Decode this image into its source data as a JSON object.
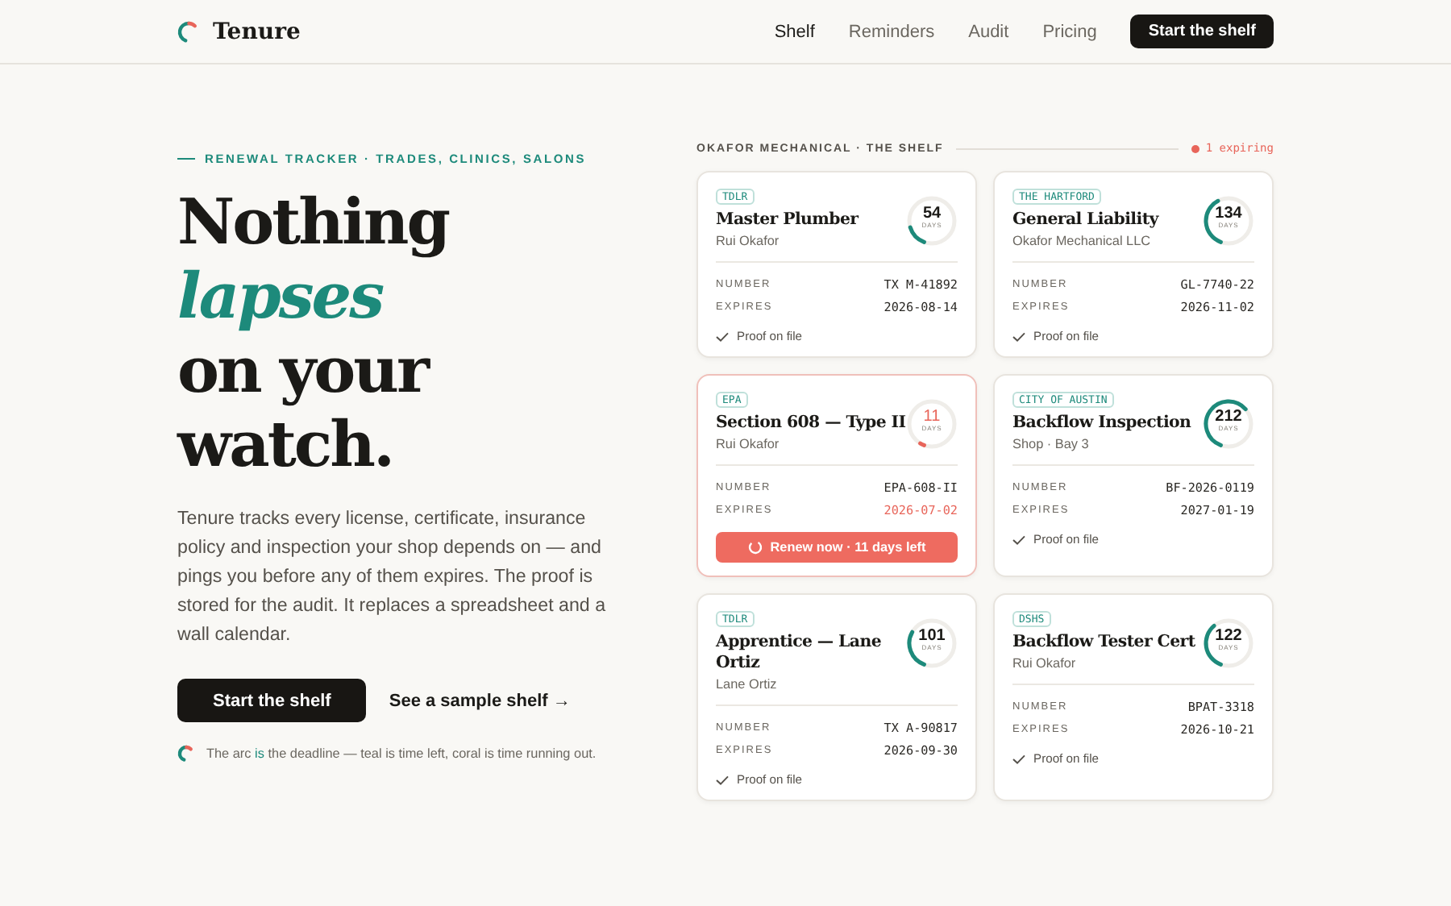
{
  "brand": {
    "name": "Tenure"
  },
  "nav": {
    "links": [
      {
        "label": "Shelf",
        "selected": true
      },
      {
        "label": "Reminders",
        "selected": false
      },
      {
        "label": "Audit",
        "selected": false
      },
      {
        "label": "Pricing",
        "selected": false
      }
    ],
    "cta": "Start the shelf"
  },
  "hero": {
    "eyebrow": "RENEWAL TRACKER · TRADES, CLINICS, SALONS",
    "headline": "Nothing *lapses* on your watch.",
    "body": "Tenure tracks every license, certificate, insurance policy and inspection your shop depends on — and pings you before any of them expires. The proof is stored for the audit. It replaces a spreadsheet and a wall calendar.",
    "primary_button": "Start the shelf",
    "secondary_link": "See a sample shelf →",
    "footnote": "The arc **is** the deadline — teal is time left, coral is time running out."
  },
  "shelf": {
    "title": "OKAFOR MECHANICAL · THE SHELF",
    "alert": "1 expiring",
    "cards": [
      {
        "kind": "ok",
        "agency": "TDLR",
        "title": "Master Plumber",
        "holder": "Rui Okafor",
        "days": "54",
        "days_label": "DAYS",
        "number_label": "NUMBER",
        "number": "TX M-41892",
        "expires_label": "EXPIRES",
        "expires": "2026-08-14",
        "footer": "Proof on file"
      },
      {
        "kind": "ok",
        "agency": "THE HARTFORD",
        "title": "General Liability",
        "holder": "Okafor Mechanical LLC",
        "days": "134",
        "days_label": "DAYS",
        "number_label": "NUMBER",
        "number": "GL-7740-22",
        "expires_label": "EXPIRES",
        "expires": "2026-11-02",
        "footer": "Proof on file"
      },
      {
        "kind": "expiring",
        "agency": "EPA",
        "title": "Section 608 — Type II",
        "holder": "Rui Okafor",
        "days": "11",
        "days_label": "DAYS",
        "number_label": "NUMBER",
        "number": "EPA-608-II",
        "expires_label": "EXPIRES",
        "expires": "2026-07-02",
        "footer": "Renew now · 11 days left"
      },
      {
        "kind": "ok",
        "agency": "CITY OF AUSTIN",
        "title": "Backflow Inspection",
        "holder": "Shop · Bay 3",
        "days": "212",
        "days_label": "DAYS",
        "number_label": "NUMBER",
        "number": "BF-2026-0119",
        "expires_label": "EXPIRES",
        "expires": "2027-01-19",
        "footer": "Proof on file"
      },
      {
        "kind": "ok",
        "agency": "TDLR",
        "title": "Apprentice — Lane Ortiz",
        "holder": "Lane Ortiz",
        "days": "101",
        "days_label": "DAYS",
        "number_label": "NUMBER",
        "number": "TX A-90817",
        "expires_label": "EXPIRES",
        "expires": "2026-09-30",
        "footer": "Proof on file"
      },
      {
        "kind": "ok",
        "agency": "DSHS",
        "title": "Backflow Tester Cert",
        "holder": "Rui Okafor",
        "days": "122",
        "days_label": "DAYS",
        "number_label": "NUMBER",
        "number": "BPAT-3318",
        "expires_label": "EXPIRES",
        "expires": "2026-10-21",
        "footer": "Proof on file"
      }
    ]
  }
}
